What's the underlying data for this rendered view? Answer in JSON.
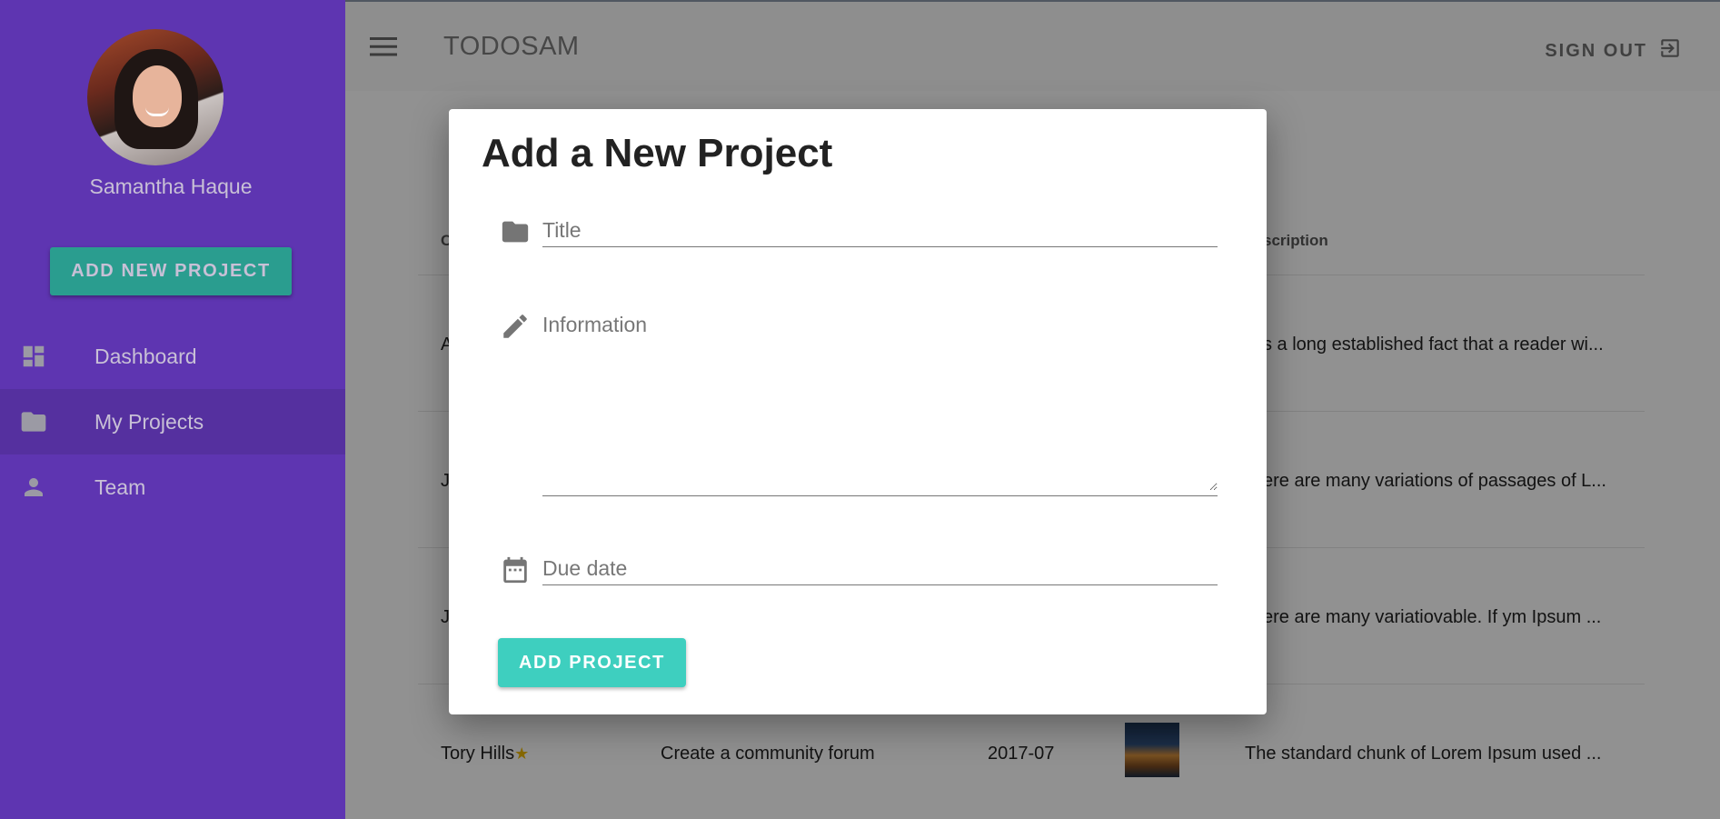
{
  "sidebar": {
    "user_name": "Samantha Haque",
    "add_button": "ADD NEW PROJECT",
    "items": [
      {
        "label": "Dashboard",
        "icon": "dashboard-icon"
      },
      {
        "label": "My Projects",
        "icon": "folder-icon"
      },
      {
        "label": "Team",
        "icon": "person-icon"
      }
    ]
  },
  "topbar": {
    "brand_light": "TODO",
    "brand_bold": "SAM",
    "signout": "SIGN OUT"
  },
  "table": {
    "visible_headers": {
      "first": "C",
      "description": "scription"
    },
    "rows": [
      {
        "first": "A",
        "description": "s a long established fact that a reader wi..."
      },
      {
        "first": "J",
        "description": "ere are many variations of passages of L..."
      },
      {
        "first": "J",
        "description": "ere are many variatiovable. If ym Ipsum ..."
      },
      {
        "first": "Tory Hills",
        "task": "Create a community forum",
        "date": "2017-07",
        "description": "The standard chunk of Lorem Ipsum used ..."
      }
    ]
  },
  "dialog": {
    "title": "Add a New Project",
    "title_placeholder": "Title",
    "information_placeholder": "Information",
    "due_date_placeholder": "Due date",
    "submit": "ADD PROJECT"
  },
  "colors": {
    "sidebar": "#5e35b1",
    "accent": "#3ecfbf",
    "backdrop": "rgba(0,0,0,0.42)"
  }
}
